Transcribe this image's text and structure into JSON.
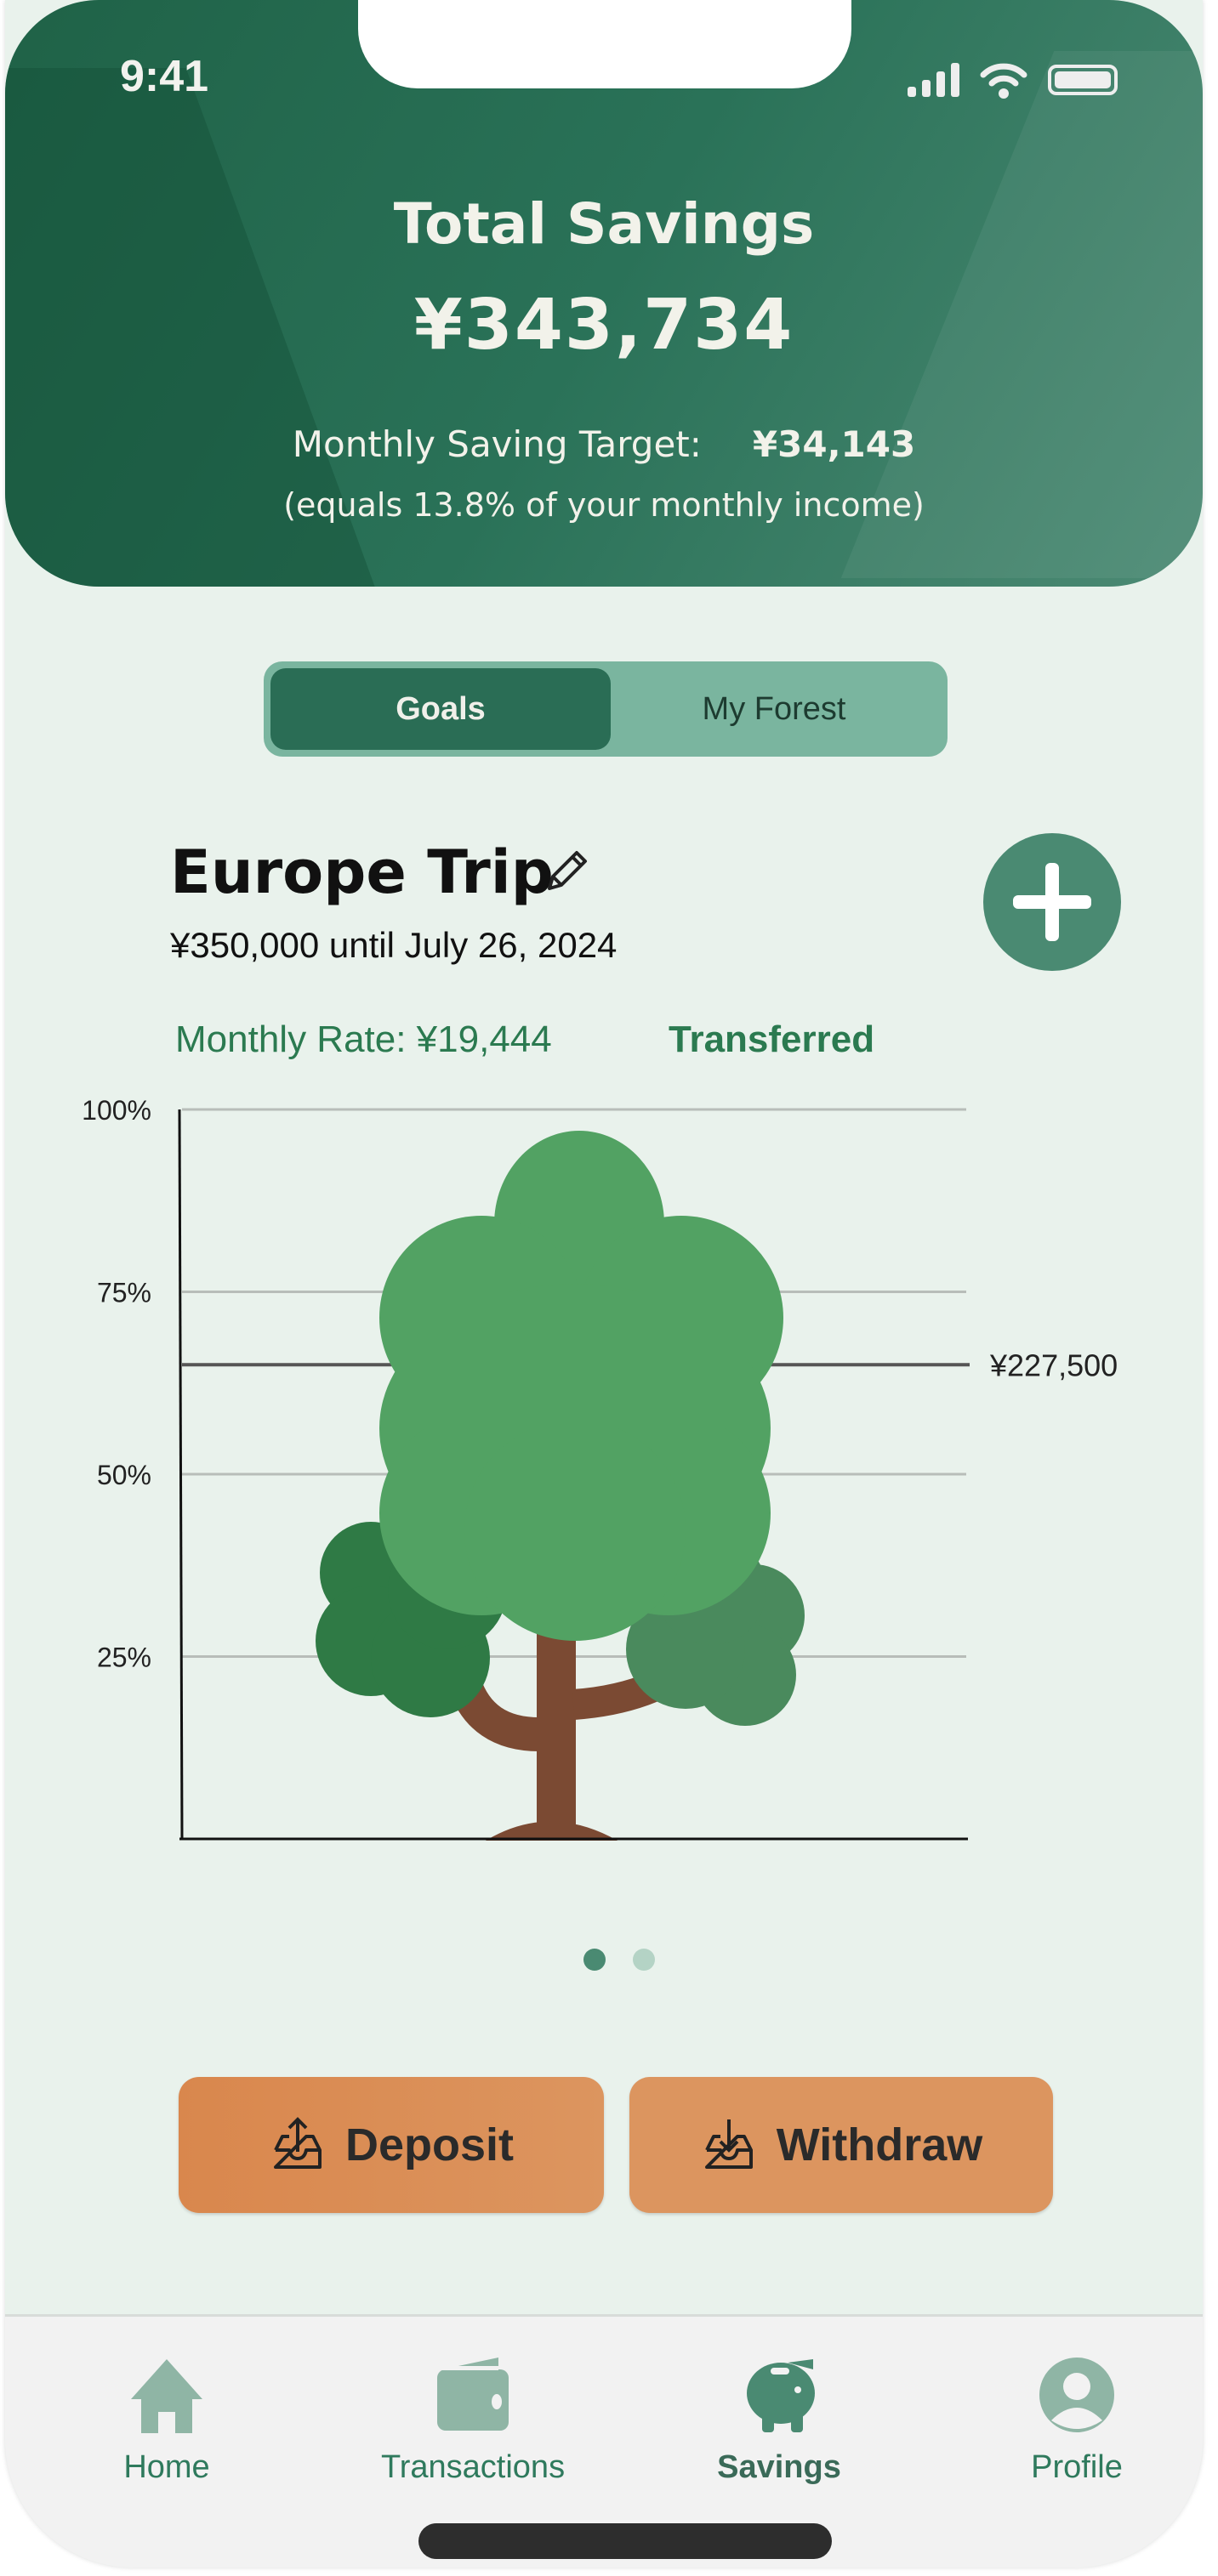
{
  "status_bar": {
    "time": "9:41"
  },
  "header": {
    "title": "Total Savings",
    "total": "¥343,734",
    "target_label": "Monthly Saving Target:",
    "target_value": "¥34,143",
    "income_note": "(equals 13.8% of your monthly income)"
  },
  "toggle": {
    "options": [
      "Goals",
      "My Forest"
    ],
    "selected": "Goals"
  },
  "goal": {
    "name": "Europe Trip",
    "summary": "¥350,000 until July 26, 2024",
    "monthly_rate": "Monthly Rate: ¥19,444",
    "status": "Transferred"
  },
  "chart_data": {
    "type": "progress",
    "y_ticks": [
      "100%",
      "75%",
      "50%",
      "25%"
    ],
    "ylim": [
      0,
      100
    ],
    "goal_amount": 350000,
    "marker_value": 227500,
    "marker_label": "¥227,500",
    "marker_percent": 65
  },
  "pagination": {
    "pages": 2,
    "current": 1
  },
  "actions": {
    "deposit": "Deposit",
    "withdraw": "Withdraw"
  },
  "tabbar": {
    "items": [
      {
        "label": "Home",
        "icon": "home-icon"
      },
      {
        "label": "Transactions",
        "icon": "wallet-icon"
      },
      {
        "label": "Savings",
        "icon": "piggy-bank-icon",
        "active": true
      },
      {
        "label": "Profile",
        "icon": "profile-icon"
      }
    ]
  },
  "colors": {
    "primary": "#2a6d55",
    "accent": "#dc955f",
    "background": "#e9f2ec",
    "success": "#2b7a50"
  }
}
